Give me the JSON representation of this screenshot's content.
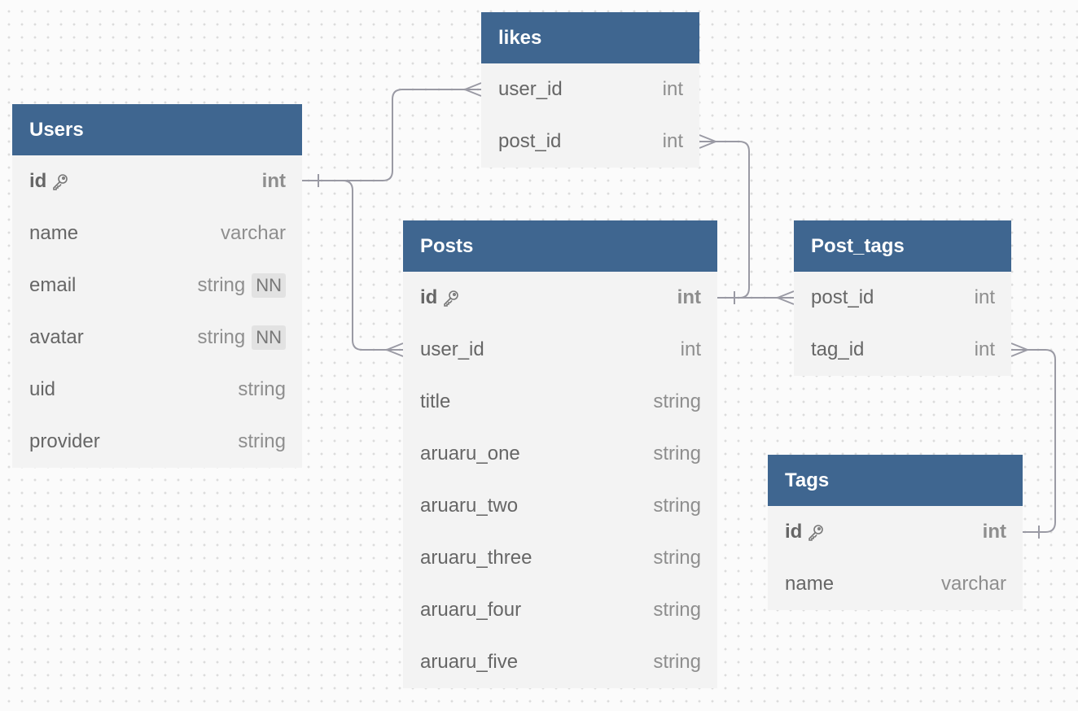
{
  "colors": {
    "header": "#3f6690",
    "body": "#f3f3f3",
    "connector": "#9a9aa4"
  },
  "tables": [
    {
      "id": "users",
      "name": "Users",
      "columns": [
        {
          "name": "id",
          "type": "int",
          "pk": true
        },
        {
          "name": "name",
          "type": "varchar"
        },
        {
          "name": "email",
          "type": "string",
          "badge": "NN"
        },
        {
          "name": "avatar",
          "type": "string",
          "badge": "NN"
        },
        {
          "name": "uid",
          "type": "string"
        },
        {
          "name": "provider",
          "type": "string"
        }
      ]
    },
    {
      "id": "likes",
      "name": "likes",
      "columns": [
        {
          "name": "user_id",
          "type": "int"
        },
        {
          "name": "post_id",
          "type": "int"
        }
      ]
    },
    {
      "id": "posts",
      "name": "Posts",
      "columns": [
        {
          "name": "id",
          "type": "int",
          "pk": true
        },
        {
          "name": "user_id",
          "type": "int"
        },
        {
          "name": "title",
          "type": "string"
        },
        {
          "name": "aruaru_one",
          "type": "string"
        },
        {
          "name": "aruaru_two",
          "type": "string"
        },
        {
          "name": "aruaru_three",
          "type": "string"
        },
        {
          "name": "aruaru_four",
          "type": "string"
        },
        {
          "name": "aruaru_five",
          "type": "string"
        }
      ]
    },
    {
      "id": "post_tags",
      "name": "Post_tags",
      "columns": [
        {
          "name": "post_id",
          "type": "int"
        },
        {
          "name": "tag_id",
          "type": "int"
        }
      ]
    },
    {
      "id": "tags",
      "name": "Tags",
      "columns": [
        {
          "name": "id",
          "type": "int",
          "pk": true
        },
        {
          "name": "name",
          "type": "varchar"
        }
      ]
    }
  ],
  "relations": [
    {
      "from": "users.id",
      "to": "likes.user_id",
      "type": "one-to-many"
    },
    {
      "from": "users.id",
      "to": "posts.user_id",
      "type": "one-to-many"
    },
    {
      "from": "posts.id",
      "to": "likes.post_id",
      "type": "one-to-many"
    },
    {
      "from": "posts.id",
      "to": "post_tags.post_id",
      "type": "one-to-many"
    },
    {
      "from": "tags.id",
      "to": "post_tags.tag_id",
      "type": "one-to-many"
    }
  ]
}
